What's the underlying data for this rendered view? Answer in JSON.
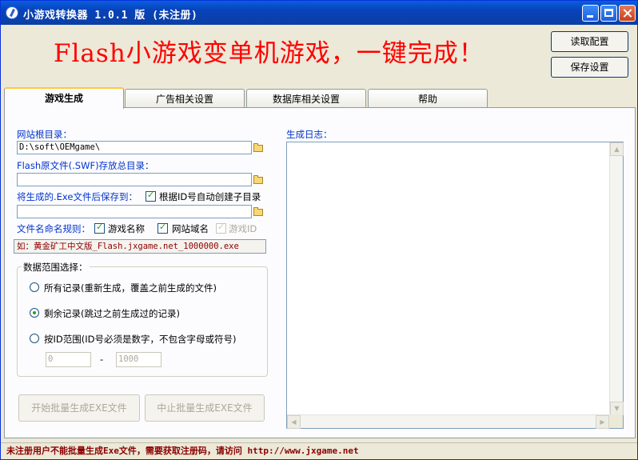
{
  "window": {
    "title": "小游戏转换器 1.0.1 版 (未注册)"
  },
  "header": {
    "headline": "Flash小游戏变单机游戏，一键完成！",
    "read_config_label": "读取配置",
    "save_config_label": "保存设置"
  },
  "tabs": [
    {
      "label": "游戏生成",
      "active": true
    },
    {
      "label": "广告相关设置",
      "active": false
    },
    {
      "label": "数据库相关设置",
      "active": false
    },
    {
      "label": "帮助",
      "active": false
    }
  ],
  "form": {
    "site_root_label": "网站根目录：",
    "site_root_value": "D:\\soft\\OEMgame\\",
    "flash_dir_label": "Flash原文件(.SWF)存放总目录：",
    "flash_dir_value": "",
    "exe_save_label": "将生成的.Exe文件后保存到：",
    "auto_subdir_label": "根据ID号自动创建子目录",
    "auto_subdir_checked": true,
    "exe_save_value": "",
    "naming_label": "文件名命名规则：",
    "naming_options": [
      {
        "label": "游戏名称",
        "checked": true,
        "enabled": true
      },
      {
        "label": "网站域名",
        "checked": true,
        "enabled": true
      },
      {
        "label": "游戏ID",
        "checked": true,
        "enabled": false
      }
    ],
    "example_text": "如：黄金矿工中文版_Flash.jxgame.net_1000000.exe"
  },
  "range_group": {
    "title": "数据范围选择：",
    "options": [
      {
        "label": "所有记录(重新生成，覆盖之前生成的文件)",
        "selected": false
      },
      {
        "label": "剩余记录(跳过之前生成过的记录)",
        "selected": true
      },
      {
        "label": "按ID范围(ID号必须是数字，不包含字母或符号)",
        "selected": false
      }
    ],
    "id_from": "0",
    "separator": "-",
    "id_to": "1000"
  },
  "actions": {
    "start_label": "开始批量生成EXE文件",
    "stop_label": "中止批量生成EXE文件"
  },
  "log": {
    "label": "生成日志："
  },
  "status_bar": {
    "text": "未注册用户不能批量生成Exe文件，需要获取注册码，请访问 http://www.jxgame.net"
  },
  "colors": {
    "headline": "#ff0000",
    "labels": "#0033cc",
    "status": "#8b0000"
  }
}
